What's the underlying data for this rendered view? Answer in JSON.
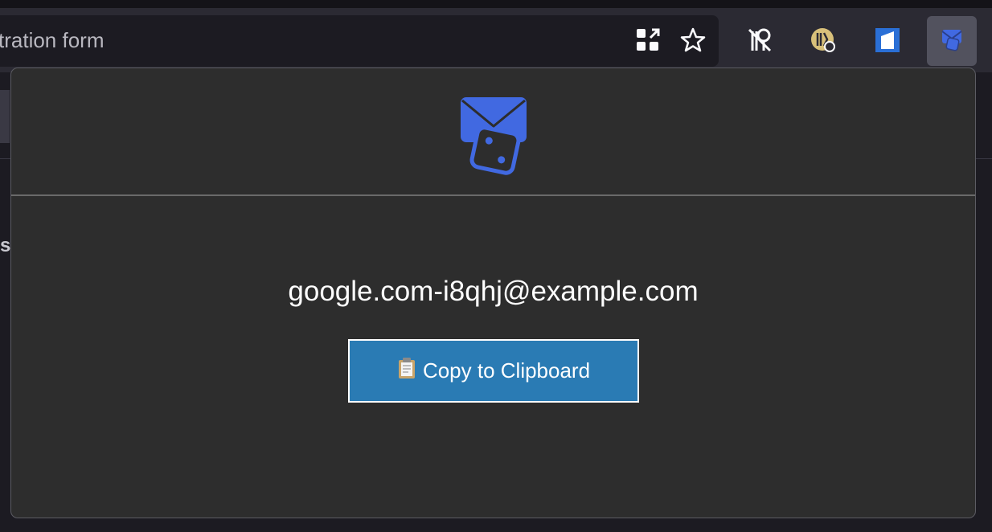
{
  "browser": {
    "url_text": "tration form",
    "toolbar_icons": [
      "extensions-grid-icon",
      "bookmark-star-icon",
      "password-manager-icon",
      "keeper-icon",
      "notion-icon",
      "email-dice-extension-icon"
    ]
  },
  "page": {
    "partial_heading": "s"
  },
  "popup": {
    "logo_icon": "envelope-dice-icon",
    "email": "google.com-i8qhj@example.com",
    "copy_button_label": "Copy to Clipboard",
    "copy_button_icon": "clipboard-icon",
    "accent_color": "#2a7bb4",
    "logo_color": "#4169e1"
  }
}
